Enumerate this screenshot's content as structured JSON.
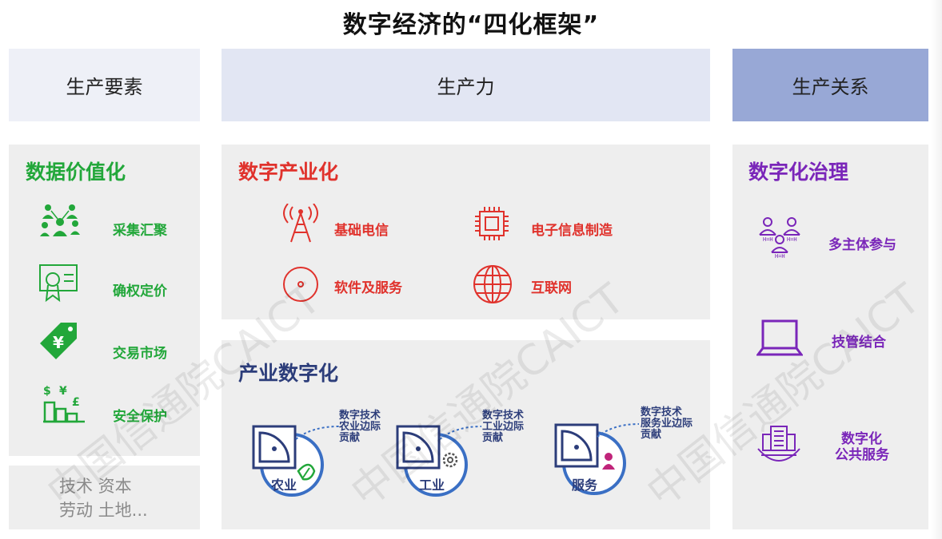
{
  "title": "数字经济的“四化框架”",
  "headers": {
    "left": "生产要素",
    "mid": "生产力",
    "right": "生产关系"
  },
  "left": {
    "title": "数据价值化",
    "items": [
      "采集汇聚",
      "确权定价",
      "交易市场",
      "安全保护"
    ],
    "factors_line1": "技术  资本",
    "factors_line2": "劳动  土地..."
  },
  "mid_top": {
    "title": "数字产业化",
    "items": [
      "基础电信",
      "电子信息制造",
      "软件及服务",
      "互联网"
    ]
  },
  "mid_bottom": {
    "title": "产业数字化",
    "sectors": [
      {
        "name": "农业",
        "note1": "数字技术",
        "note2": "农业边际",
        "note3": "贡献"
      },
      {
        "name": "工业",
        "note1": "数字技术",
        "note2": "工业边际",
        "note3": "贡献"
      },
      {
        "name": "服务",
        "note1": "数字技术",
        "note2": "服务业边际",
        "note3": "贡献"
      }
    ]
  },
  "right": {
    "title": "数字化治理",
    "items": [
      "多主体参与",
      "技管结合",
      "数字化",
      "公共服务"
    ]
  },
  "watermark": "中国信通院CAICT",
  "colors": {
    "green": "#22a73a",
    "red": "#e0322c",
    "navy": "#2c3d7a",
    "purple": "#7a26b9",
    "blue": "#3a6fc4"
  }
}
